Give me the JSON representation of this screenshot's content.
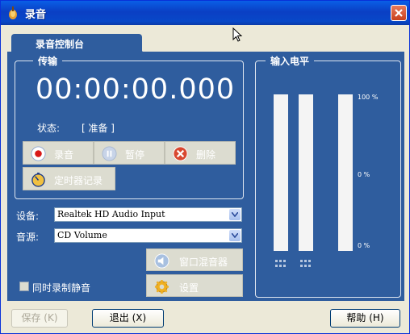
{
  "window": {
    "title": "录音",
    "close_icon": "close-icon"
  },
  "tab": {
    "label": "录音控制台"
  },
  "transfer": {
    "group_title": "传输",
    "timer": "00:00:00.000",
    "status_label": "状态:",
    "status_value": "[ 准备 ]",
    "buttons": {
      "record": "录音",
      "pause": "暂停",
      "delete": "删除",
      "timer_record": "定时器记录"
    }
  },
  "device": {
    "label": "设备:",
    "value": "Realtek HD Audio Input"
  },
  "source": {
    "label": "音源:",
    "value": "CD Volume"
  },
  "mixer_button": "窗口混音器",
  "settings_button": "设置",
  "record_silence": {
    "label": "同时录制静音",
    "checked": false
  },
  "input_level": {
    "group_title": "输入电平",
    "scale": [
      "100 %",
      "0 %",
      "0 %"
    ],
    "level_left": 0,
    "level_right": 0
  },
  "footer": {
    "save": "保存 (K)",
    "exit": "退出 (X)",
    "help": "帮助 (H)"
  },
  "colors": {
    "panel": "#2f5d9e",
    "titlebar": "#0a5fe6",
    "window_bg": "#ece9d8"
  }
}
